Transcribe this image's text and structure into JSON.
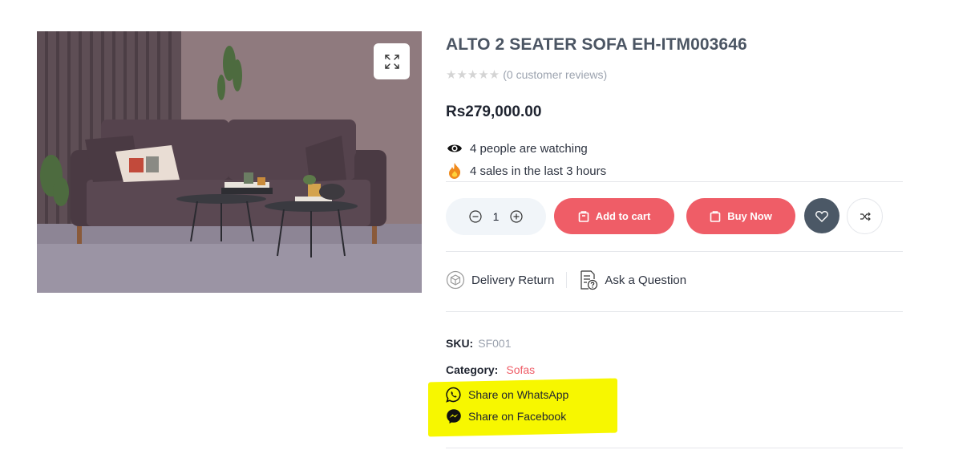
{
  "product": {
    "title": "ALTO 2 SEATER SOFA EH-ITM003646",
    "stars": "★★★★★",
    "reviews": "(0 customer reviews)",
    "price": "Rs279,000.00",
    "watching": "4 people are watching",
    "sales": "4 sales in the last 3 hours",
    "sku_label": "SKU:",
    "sku": "SF001",
    "category_label": "Category:",
    "category": "Sofas"
  },
  "cart": {
    "quantity": "1",
    "add_to_cart": "Add to cart",
    "buy_now": "Buy Now"
  },
  "links": {
    "delivery": "Delivery Return",
    "ask": "Ask a Question"
  },
  "share": {
    "whatsapp": "Share on WhatsApp",
    "facebook": "Share on Facebook"
  },
  "colors": {
    "accent": "#ef5d67",
    "wishlist": "#4b5866",
    "highlight": "#f7f700"
  },
  "icons": [
    "expand-icon",
    "eye-icon",
    "fire-icon",
    "minus-icon",
    "plus-icon",
    "bag-icon",
    "heart-icon",
    "shuffle-icon",
    "delivery-box-icon",
    "question-doc-icon",
    "whatsapp-icon",
    "messenger-icon"
  ]
}
